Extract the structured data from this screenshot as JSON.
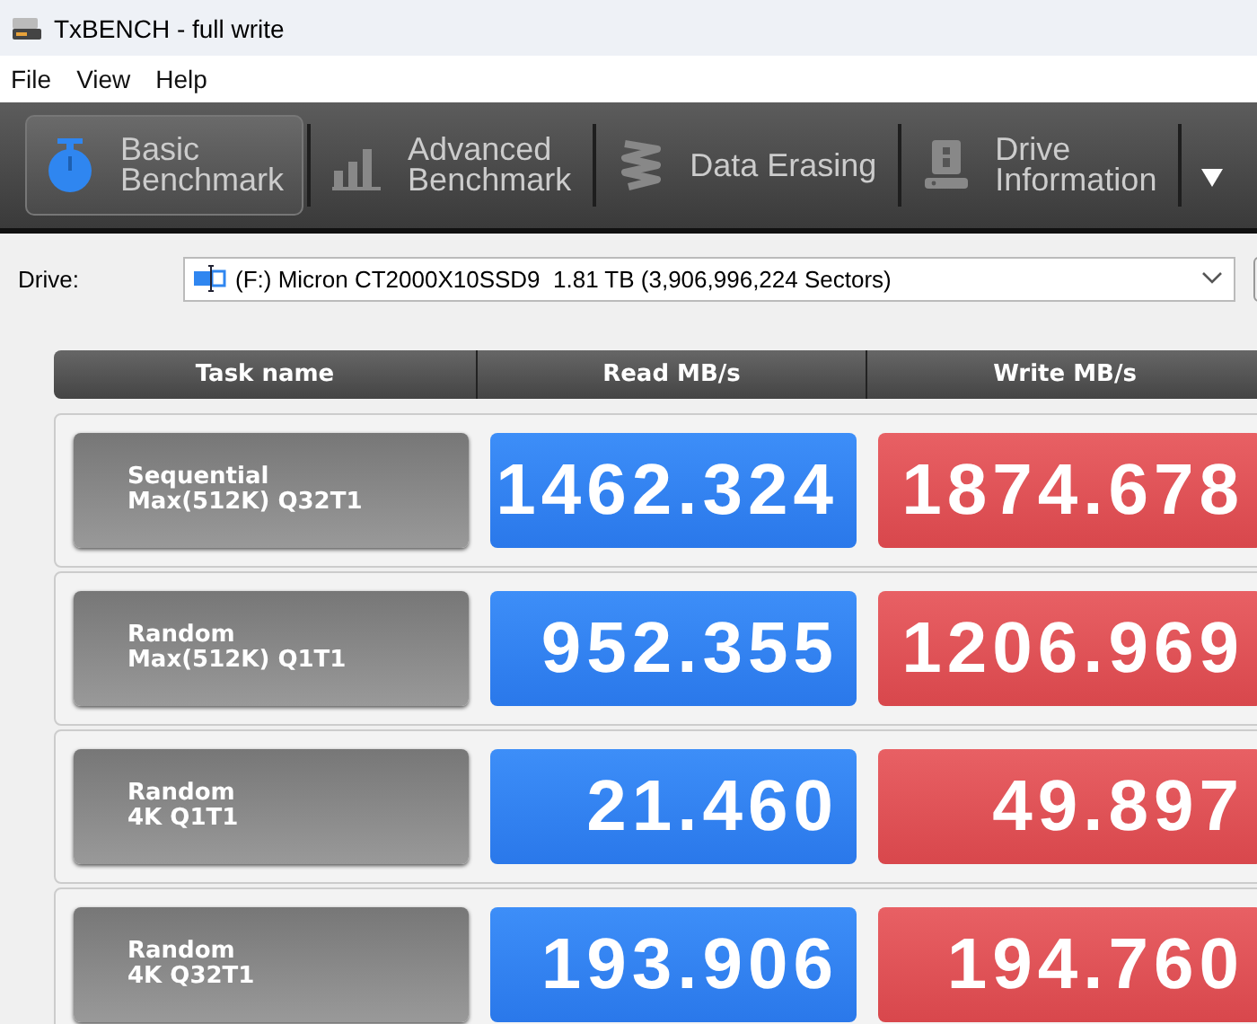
{
  "window": {
    "title": "TxBENCH - full write"
  },
  "menu": [
    "File",
    "View",
    "Help"
  ],
  "tabs": [
    {
      "kind": "stopwatch",
      "label": "Basic\nBenchmark",
      "selected": true
    },
    {
      "kind": "bars",
      "label": "Advanced\nBenchmark",
      "selected": false
    },
    {
      "kind": "spring",
      "label": "Data Erasing",
      "selected": false
    },
    {
      "kind": "drive",
      "label": "Drive\nInformation",
      "selected": false
    }
  ],
  "drive": {
    "label": "Drive:",
    "value": "(F:) Micron CT2000X10SSD9  1.81 TB (3,906,996,224 Sectors)"
  },
  "table": {
    "columns": [
      "Task name",
      "Read MB/s",
      "Write MB/s"
    ],
    "rows": [
      {
        "task": "Sequential\nMax(512K) Q32T1",
        "read": "1462.324",
        "write": "1874.678"
      },
      {
        "task": "Random\nMax(512K) Q1T1",
        "read": "952.355",
        "write": "1206.969"
      },
      {
        "task": "Random\n4K Q1T1",
        "read": "21.460",
        "write": "49.897"
      },
      {
        "task": "Random\n4K Q32T1",
        "read": "193.906",
        "write": "194.760"
      }
    ]
  }
}
